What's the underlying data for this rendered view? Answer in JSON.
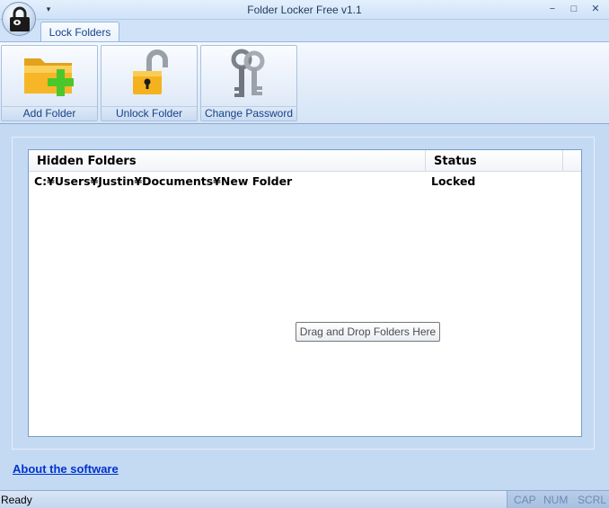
{
  "window": {
    "title": "Folder Locker Free v1.1",
    "minimize": "−",
    "maximize": "□",
    "close": "✕",
    "qat": "▾"
  },
  "ribbon": {
    "tab": "Lock Folders",
    "buttons": [
      {
        "label": "Add Folder",
        "icon": "folder-add-icon"
      },
      {
        "label": "Unlock Folder",
        "icon": "padlock-open-icon"
      },
      {
        "label": "Change Password",
        "icon": "keys-icon"
      }
    ]
  },
  "list": {
    "columns": [
      "Hidden Folders",
      "Status"
    ],
    "rows": [
      {
        "path": "C:¥Users¥Justin¥Documents¥New Folder",
        "status": "Locked"
      }
    ],
    "drop_hint": "Drag and Drop Folders Here"
  },
  "links": {
    "about": "About the software"
  },
  "statusbar": {
    "text": "Ready",
    "indicators": [
      "CAP",
      "NUM",
      "SCRL"
    ]
  },
  "colors": {
    "window_bg": "#c4daf3",
    "ribbon_text": "#15428b",
    "link": "#0033cc",
    "folder": "#f7b628",
    "plus": "#4cc72b"
  }
}
